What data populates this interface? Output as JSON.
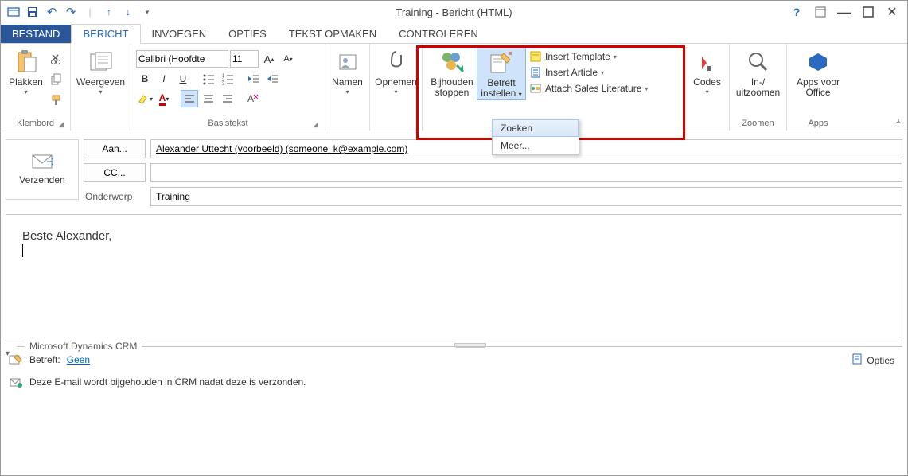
{
  "window": {
    "title": "Training - Bericht (HTML)"
  },
  "tabs": {
    "file": "BESTAND",
    "message": "BERICHT",
    "insert": "INVOEGEN",
    "options": "OPTIES",
    "format": "TEKST OPMAKEN",
    "review": "CONTROLEREN"
  },
  "ribbon": {
    "clipboard": {
      "paste": "Plakken",
      "label": "Klembord"
    },
    "show": {
      "btn": "Weergeven",
      "label": ""
    },
    "basic_text": {
      "font": "Calibri (Hoofdte",
      "size": "11",
      "label": "Basistekst"
    },
    "names": {
      "btn": "Namen",
      "label": ""
    },
    "include": {
      "btn": "Opnemen",
      "label": ""
    },
    "crm": {
      "track_stop": "Bijhouden stoppen",
      "set_regarding": "Betreft instellen",
      "insert_template": "Insert Template",
      "insert_article": "Insert Article",
      "attach_sales": "Attach Sales Literature",
      "dropdown": {
        "search": "Zoeken",
        "more": "Meer..."
      }
    },
    "codes": {
      "btn": "Codes"
    },
    "zoom": {
      "btn": "In-/ uitzoomen",
      "label": "Zoomen"
    },
    "apps": {
      "btn": "Apps voor Office",
      "label": "Apps"
    }
  },
  "compose": {
    "send": "Verzenden",
    "to_btn": "Aan...",
    "to_value": "Alexander Uttecht (voorbeeld) (someone_k@example.com)",
    "cc_btn": "CC...",
    "cc_value": "",
    "subject_label": "Onderwerp",
    "subject_value": "Training"
  },
  "body": {
    "line1": "Beste Alexander,"
  },
  "crm_pane": {
    "title": "Microsoft Dynamics CRM",
    "regarding_label": "Betreft:",
    "regarding_value": "Geen",
    "status": "Deze E-mail wordt bijgehouden in CRM nadat deze is verzonden.",
    "options": "Opties"
  }
}
